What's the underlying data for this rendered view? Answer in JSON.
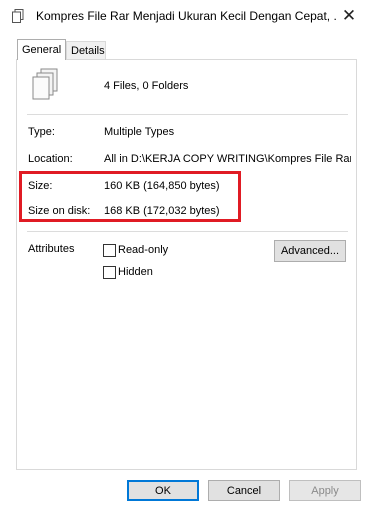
{
  "window": {
    "title": "Kompres File Rar Menjadi Ukuran Kecil Dengan Cepat, ....",
    "title_icon": "document-icon",
    "close_glyph": "✕"
  },
  "tabs": [
    {
      "label": "General",
      "active": true
    },
    {
      "label": "Details",
      "active": false
    }
  ],
  "summary": {
    "icon": "multiple-files-icon",
    "text": "4 Files, 0 Folders"
  },
  "properties": {
    "type_label": "Type:",
    "type_value": "Multiple Types",
    "location_label": "Location:",
    "location_value": "All in D:\\KERJA COPY WRITING\\Kompres File Rar M",
    "size_label": "Size:",
    "size_value": "160 KB (164,850 bytes)",
    "size_on_disk_label": "Size on disk:",
    "size_on_disk_value": "168 KB (172,032 bytes)"
  },
  "attributes": {
    "label": "Attributes",
    "readonly_label": "Read-only",
    "hidden_label": "Hidden",
    "readonly_checked": false,
    "hidden_checked": false,
    "advanced_button": "Advanced..."
  },
  "footer": {
    "ok": "OK",
    "cancel": "Cancel",
    "apply": "Apply"
  },
  "colors": {
    "highlight_border": "#e01b24",
    "primary_border": "#0078d7"
  }
}
